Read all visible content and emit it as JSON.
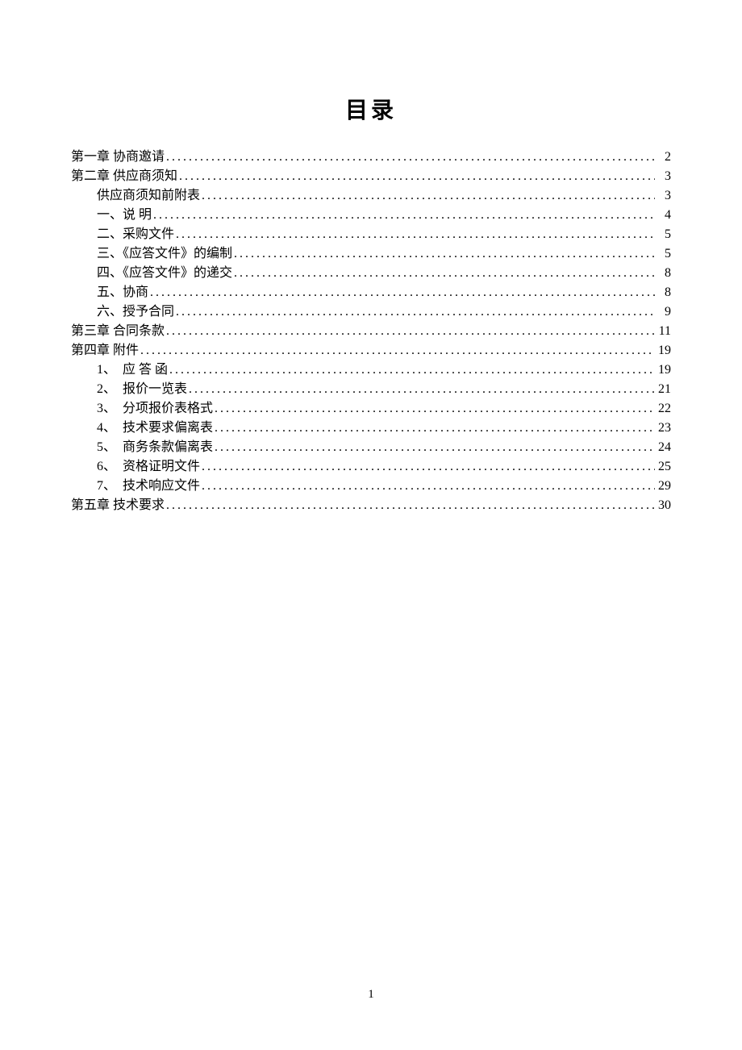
{
  "title": "目录",
  "page_number": "1",
  "toc": [
    {
      "level": 0,
      "label": "第一章 协商邀请",
      "page": "2"
    },
    {
      "level": 0,
      "label": "第二章 供应商须知",
      "page": "3"
    },
    {
      "level": 1,
      "label": "供应商须知前附表",
      "page": "3"
    },
    {
      "level": 1,
      "label": "一、说 明",
      "page": "4"
    },
    {
      "level": 1,
      "label": "二、采购文件",
      "page": "5"
    },
    {
      "level": 1,
      "label": "三、《应答文件》的编制",
      "page": "5"
    },
    {
      "level": 1,
      "label": "四、《应答文件》的递交",
      "page": "8"
    },
    {
      "level": 1,
      "label": "五、协商",
      "page": "8"
    },
    {
      "level": 1,
      "label": "六、授予合同",
      "page": "9"
    },
    {
      "level": 0,
      "label": "第三章 合同条款",
      "page": "11"
    },
    {
      "level": 0,
      "label": "第四章 附件",
      "page": "19"
    },
    {
      "level": 1,
      "label": "1、  应 答 函",
      "page": "19"
    },
    {
      "level": 1,
      "label": "2、  报价一览表",
      "page": "21"
    },
    {
      "level": 1,
      "label": "3、  分项报价表格式",
      "page": "22"
    },
    {
      "level": 1,
      "label": "4、  技术要求偏离表",
      "page": "23"
    },
    {
      "level": 1,
      "label": "5、  商务条款偏离表",
      "page": "24"
    },
    {
      "level": 1,
      "label": "6、  资格证明文件",
      "page": "25"
    },
    {
      "level": 1,
      "label": "7、  技术响应文件",
      "page": "29"
    },
    {
      "level": 0,
      "label": "第五章 技术要求",
      "page": "30"
    }
  ]
}
